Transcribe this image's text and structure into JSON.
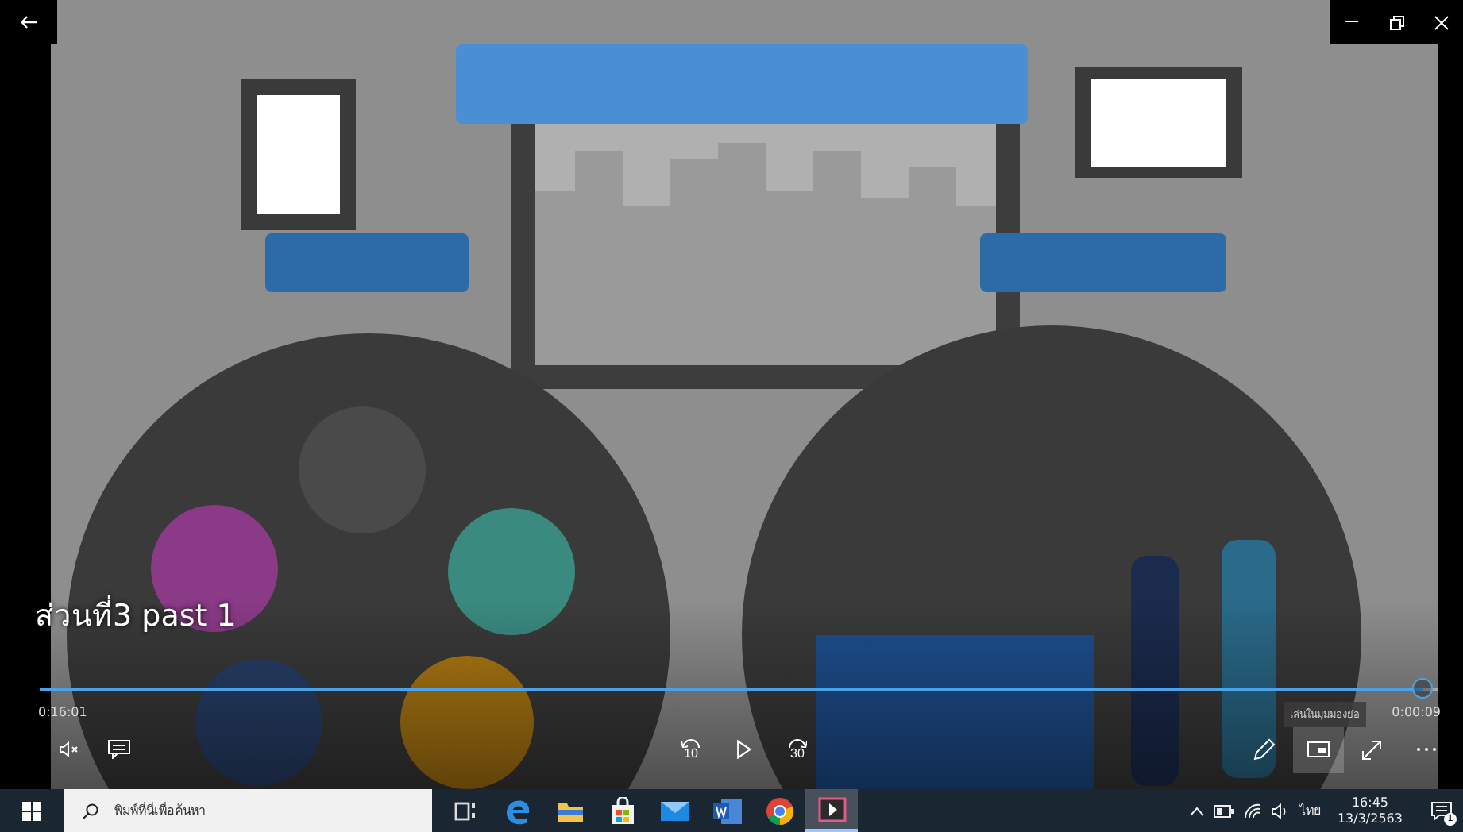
{
  "player": {
    "title": "ส่วนที่3 past 1",
    "elapsed": "0:16:01",
    "remaining": "0:00:09",
    "level": 0.99,
    "skip_back": "10",
    "skip_forward": "30",
    "tooltip": "เล่นในมุมมองย่อ"
  },
  "taskbar": {
    "search_placeholder": "พิมพ์ที่นี่เพื่อค้นหา",
    "apps": [
      {
        "kind": "task-view",
        "selected": false
      },
      {
        "kind": "edge",
        "selected": false
      },
      {
        "kind": "files",
        "selected": false
      },
      {
        "kind": "store",
        "selected": false
      },
      {
        "kind": "mail",
        "selected": false
      },
      {
        "kind": "word",
        "selected": false
      },
      {
        "kind": "chrome",
        "selected": false
      },
      {
        "kind": "movies",
        "selected": true
      }
    ],
    "tray": {
      "language": "ไทย",
      "time": "16:45",
      "date": "13/3/2563",
      "notification_count": "1"
    }
  }
}
